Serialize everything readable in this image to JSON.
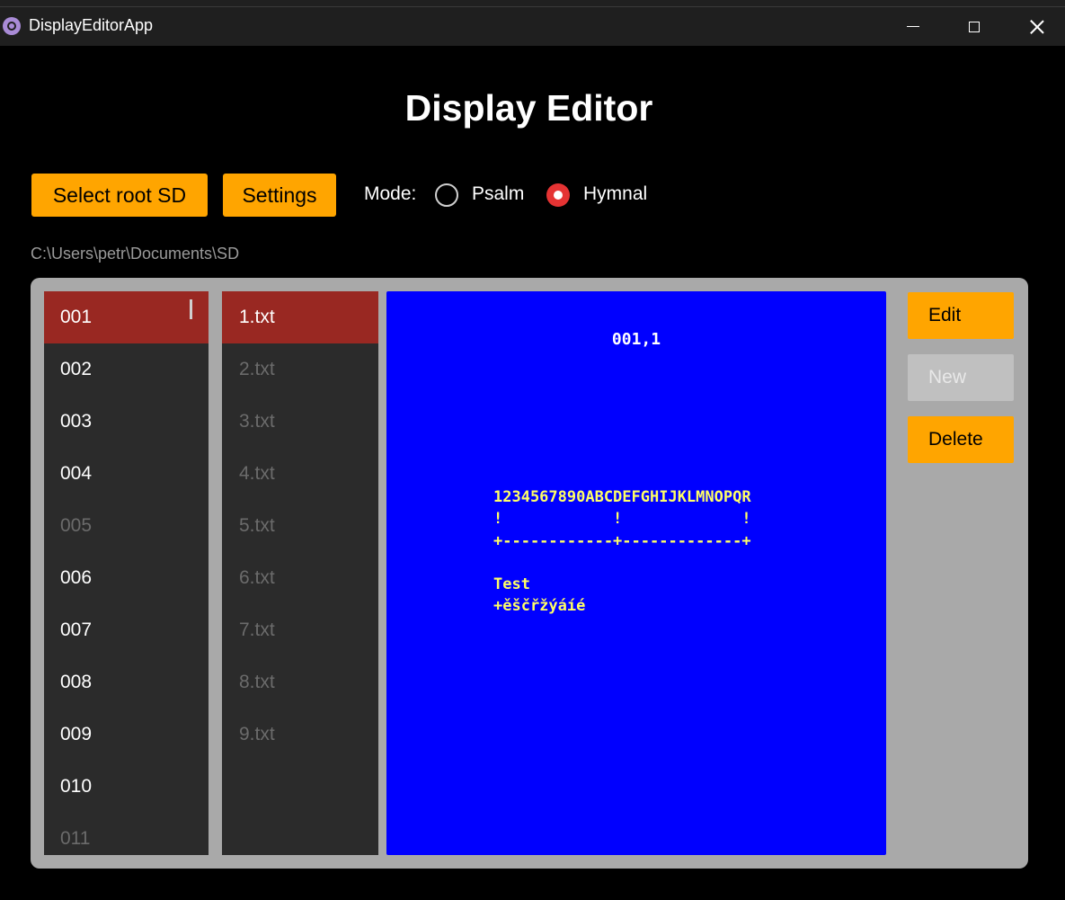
{
  "window": {
    "title": "DisplayEditorApp"
  },
  "header": {
    "title": "Display Editor"
  },
  "toolbar": {
    "select_root_label": "Select root SD",
    "settings_label": "Settings",
    "mode_label": "Mode:",
    "mode_options": [
      {
        "label": "Psalm",
        "selected": false
      },
      {
        "label": "Hymnal",
        "selected": true
      }
    ]
  },
  "root_path": "C:\\Users\\petr\\Documents\\SD",
  "folders": [
    {
      "label": "001",
      "selected": true,
      "enabled": true
    },
    {
      "label": "002",
      "selected": false,
      "enabled": true
    },
    {
      "label": "003",
      "selected": false,
      "enabled": true
    },
    {
      "label": "004",
      "selected": false,
      "enabled": true
    },
    {
      "label": "005",
      "selected": false,
      "enabled": false
    },
    {
      "label": "006",
      "selected": false,
      "enabled": true
    },
    {
      "label": "007",
      "selected": false,
      "enabled": true
    },
    {
      "label": "008",
      "selected": false,
      "enabled": true
    },
    {
      "label": "009",
      "selected": false,
      "enabled": true
    },
    {
      "label": "010",
      "selected": false,
      "enabled": true
    },
    {
      "label": "011",
      "selected": false,
      "enabled": false
    }
  ],
  "files": [
    {
      "label": "1.txt",
      "selected": true,
      "enabled": true
    },
    {
      "label": "2.txt",
      "selected": false,
      "enabled": false
    },
    {
      "label": "3.txt",
      "selected": false,
      "enabled": false
    },
    {
      "label": "4.txt",
      "selected": false,
      "enabled": false
    },
    {
      "label": "5.txt",
      "selected": false,
      "enabled": false
    },
    {
      "label": "6.txt",
      "selected": false,
      "enabled": false
    },
    {
      "label": "7.txt",
      "selected": false,
      "enabled": false
    },
    {
      "label": "8.txt",
      "selected": false,
      "enabled": false
    },
    {
      "label": "9.txt",
      "selected": false,
      "enabled": false
    }
  ],
  "display": {
    "header": "001,1",
    "lines": [
      "1234567890ABCDEFGHIJKLMNOPQR",
      "!            !             !",
      "+------------+-------------+",
      "",
      "Test",
      "+ěščřžýáíé"
    ],
    "background_color": "#0000ff",
    "text_color": "#ffff66"
  },
  "actions": {
    "edit_label": "Edit",
    "new_label": "New",
    "new_enabled": false,
    "delete_label": "Delete"
  },
  "colors": {
    "accent": "#ffa500",
    "selection": "#992822",
    "radio_selected": "#e53333"
  }
}
